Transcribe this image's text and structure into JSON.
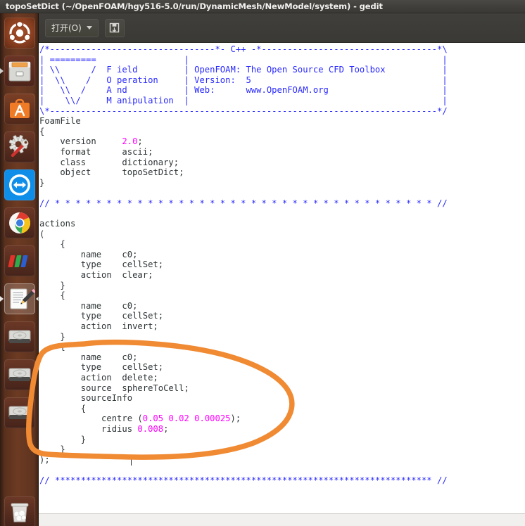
{
  "window": {
    "title": "topoSetDict (~/OpenFOAM/hgy516-5.0/run/DynamicMesh/NewModel/system) - gedit",
    "app": "gedit",
    "filename": "topoSetDict",
    "path": "~/OpenFOAM/hgy516-5.0/run/DynamicMesh/NewModel/system"
  },
  "toolbar": {
    "open_label": "打开(O)",
    "open_caret_icon": "chevron-down-icon",
    "save_icon": "save-icon"
  },
  "launcher": {
    "items": [
      {
        "name": "ubuntu-dash",
        "label": "Ubuntu Dash",
        "running": false
      },
      {
        "name": "files",
        "label": "Files",
        "running": true
      },
      {
        "name": "ubuntu-software",
        "label": "Ubuntu Software",
        "running": false
      },
      {
        "name": "system-settings",
        "label": "System Settings",
        "running": false
      },
      {
        "name": "teamviewer",
        "label": "TeamViewer",
        "running": false
      },
      {
        "name": "google-chrome",
        "label": "Google Chrome",
        "running": false
      },
      {
        "name": "wps-office",
        "label": "WPS Office",
        "running": false
      },
      {
        "name": "gedit",
        "label": "gedit",
        "running": true,
        "focused": true
      },
      {
        "name": "disk-volume-1",
        "label": "Disk Volume",
        "running": false
      },
      {
        "name": "disk-volume-2",
        "label": "Disk Volume",
        "running": false
      },
      {
        "name": "disk-volume-3",
        "label": "Disk Volume",
        "running": false
      },
      {
        "name": "trash",
        "label": "Trash",
        "running": false
      }
    ]
  },
  "editor": {
    "caret_line": "ridius 0.008;",
    "code_lines": [
      "/*--------------------------------*- C++ -*----------------------------------*\\",
      "| =========                 |                                                 |",
      "| \\\\      /  F ield         | OpenFOAM: The Open Source CFD Toolbox           |",
      "|  \\\\    /   O peration     | Version:  5                                     |",
      "|   \\\\  /    A nd           | Web:      www.OpenFOAM.org                      |",
      "|    \\\\/     M anipulation  |                                                 |",
      "\\*---------------------------------------------------------------------------*/",
      "FoamFile",
      "{",
      "    version     2.0;",
      "    format      ascii;",
      "    class       dictionary;",
      "    object      topoSetDict;",
      "}",
      "",
      "// * * * * * * * * * * * * * * * * * * * * * * * * * * * * * * * * * * * * * //",
      "",
      "actions",
      "(",
      "    {",
      "        name    c0;",
      "        type    cellSet;",
      "        action  clear;",
      "    }",
      "    {",
      "        name    c0;",
      "        type    cellSet;",
      "        action  invert;",
      "    }",
      "    {",
      "        name    c0;",
      "        type    cellSet;",
      "        action  delete;",
      "        source  sphereToCell;",
      "        sourceInfo",
      "        {",
      "            centre (0.05 0.02 0.00025);",
      "            ridius 0.008;",
      "        }",
      "    }",
      ");",
      "",
      "// ************************************************************************* //"
    ],
    "foam_file": {
      "version": "2.0",
      "format": "ascii",
      "class": "dictionary",
      "object": "topoSetDict"
    },
    "actions": [
      {
        "name": "c0",
        "type": "cellSet",
        "action": "clear"
      },
      {
        "name": "c0",
        "type": "cellSet",
        "action": "invert"
      },
      {
        "name": "c0",
        "type": "cellSet",
        "action": "delete",
        "source": "sphereToCell",
        "sourceInfo": {
          "centre": "(0.05 0.02 0.00025)",
          "ridius": "0.008"
        }
      }
    ]
  },
  "annotation": {
    "name": "orange-highlight-circle",
    "color": "#f08a33",
    "stroke_width": 7,
    "encircles": "third action block: name c0 / type cellSet / action delete / source sphereToCell / sourceInfo { centre (0.05 0.02 0.00025); ridius 0.008; }"
  },
  "colors": {
    "comment": "#2929ff",
    "number": "#ff00ff",
    "text": "#2e3436",
    "editor_bg": "#ffffff",
    "panel_bg": "#3c3b37",
    "launcher_bg": "#6d3a22",
    "annotation": "#f08a33"
  }
}
